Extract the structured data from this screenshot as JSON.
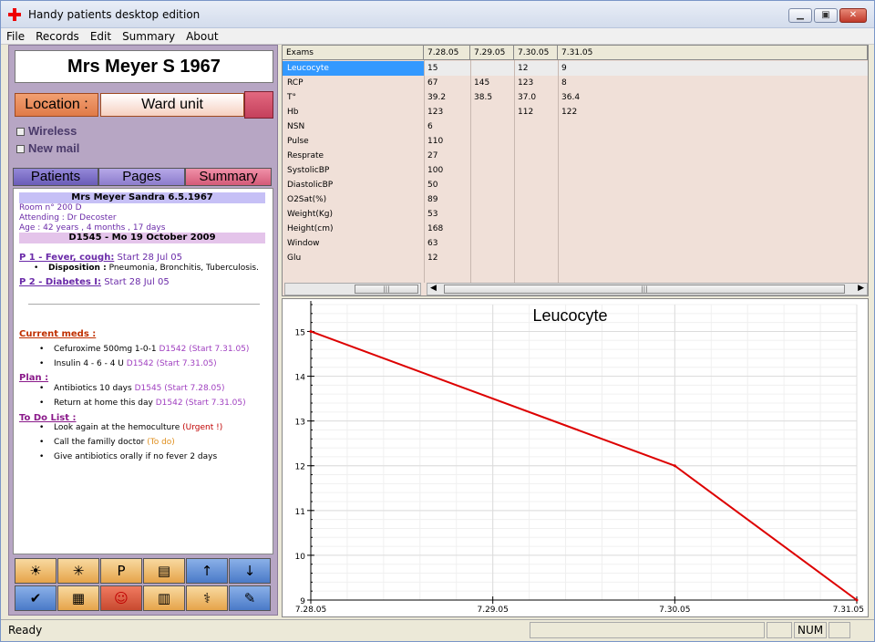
{
  "window": {
    "title": "Handy patients desktop edition",
    "min": "▁",
    "max": "▣",
    "close": "✕"
  },
  "menu": [
    "File",
    "Records",
    "Edit",
    "Summary",
    "About"
  ],
  "patient": {
    "name": "Mrs Meyer S 1967"
  },
  "location": {
    "label": "Location :",
    "value": "Ward unit"
  },
  "checks": [
    {
      "label": "Wireless"
    },
    {
      "label": "New mail"
    }
  ],
  "tabs": [
    {
      "label": "Patients"
    },
    {
      "label": "Pages"
    },
    {
      "label": "Summary"
    }
  ],
  "summary": {
    "header": "Mrs Meyer Sandra 6.5.1967",
    "room": "Room n° 200 D",
    "attending": "Attending : Dr Decoster",
    "age": "Age : 42 years , 4 months , 17 days",
    "visit": "D1545 - Mo 19 October 2009",
    "problems": [
      {
        "title": "P 1 - Fever, cough:",
        "start": "Start 28 Jul 05",
        "disp_label": "Disposition :",
        "disp": "Pneumonia, Bronchitis, Tuberculosis."
      },
      {
        "title": "P 2 - Diabetes I:",
        "start": "Start 28 Jul 05"
      }
    ],
    "meds_title": "Current meds :",
    "meds": [
      {
        "text": "Cefuroxime 500mg 1-0-1",
        "ref": "D1542 (Start 7.31.05)"
      },
      {
        "text": "Insulin 4 - 6 - 4 U",
        "ref": "D1542 (Start 7.31.05)"
      }
    ],
    "plan_title": "Plan :",
    "plan": [
      {
        "text": "Antibiotics 10 days",
        "ref": "D1545 (Start 7.28.05)"
      },
      {
        "text": "Return at home this day",
        "ref": "D1542 (Start 7.31.05)"
      }
    ],
    "todo_title": "To Do List :",
    "todo": [
      {
        "text": "Look again at the hemoculture",
        "tag": "(Urgent !)"
      },
      {
        "text": "Call the familly doctor",
        "tag": "(To do)"
      },
      {
        "text": "Give antibiotics orally if no fever 2 days",
        "tag": ""
      }
    ]
  },
  "toolbar": [
    "sun-icon",
    "chart-icon",
    "parking-icon",
    "printer-icon",
    "arrow-up-icon",
    "arrow-down-icon",
    "checkmark-icon",
    "grid-icon",
    "person-icon",
    "family-icon",
    "temperature-icon",
    "edit-icon"
  ],
  "toolbar_glyphs": [
    "☀",
    "✳",
    "P",
    "▤",
    "↑",
    "↓",
    "✔",
    "▦",
    "☺",
    "▥",
    "⚕",
    "✎"
  ],
  "grid": {
    "exam_header": "Exams",
    "dates": [
      "7.28.05",
      "7.29.05",
      "7.30.05",
      "7.31.05"
    ],
    "rows": [
      {
        "name": "Leucocyte",
        "vals": [
          "15",
          "",
          "12",
          "9"
        ]
      },
      {
        "name": "RCP",
        "vals": [
          "67",
          "145",
          "123",
          "8"
        ]
      },
      {
        "name": "T°",
        "vals": [
          "39.2",
          "38.5",
          "37.0",
          "36.4"
        ]
      },
      {
        "name": "Hb",
        "vals": [
          "123",
          "",
          "112",
          "122"
        ]
      },
      {
        "name": "NSN",
        "vals": [
          "6",
          "",
          "",
          ""
        ]
      },
      {
        "name": "Pulse",
        "vals": [
          "110",
          "",
          "",
          ""
        ]
      },
      {
        "name": "Resprate",
        "vals": [
          "27",
          "",
          "",
          ""
        ]
      },
      {
        "name": "SystolicBP",
        "vals": [
          "100",
          "",
          "",
          ""
        ]
      },
      {
        "name": "DiastolicBP",
        "vals": [
          "50",
          "",
          "",
          ""
        ]
      },
      {
        "name": "O2Sat(%)",
        "vals": [
          "89",
          "",
          "",
          ""
        ]
      },
      {
        "name": "Weight(Kg)",
        "vals": [
          "53",
          "",
          "",
          ""
        ]
      },
      {
        "name": "Height(cm)",
        "vals": [
          "168",
          "",
          "",
          ""
        ]
      },
      {
        "name": "Window",
        "vals": [
          "63",
          "",
          "",
          ""
        ]
      },
      {
        "name": "Glu",
        "vals": [
          "12",
          "",
          "",
          ""
        ]
      }
    ]
  },
  "chart_data": {
    "type": "line",
    "title": "Leucocyte",
    "x": [
      "7.28.05",
      "7.29.05",
      "7.30.05",
      "7.31.05"
    ],
    "series": [
      {
        "values": [
          15,
          null,
          12,
          9
        ]
      }
    ],
    "ylim": [
      9,
      15.6
    ],
    "yticks": [
      9,
      10,
      11,
      12,
      13,
      14,
      15
    ],
    "grid": true,
    "line_color": "#dd0000"
  },
  "status": {
    "text": "Ready",
    "num": "NUM"
  }
}
